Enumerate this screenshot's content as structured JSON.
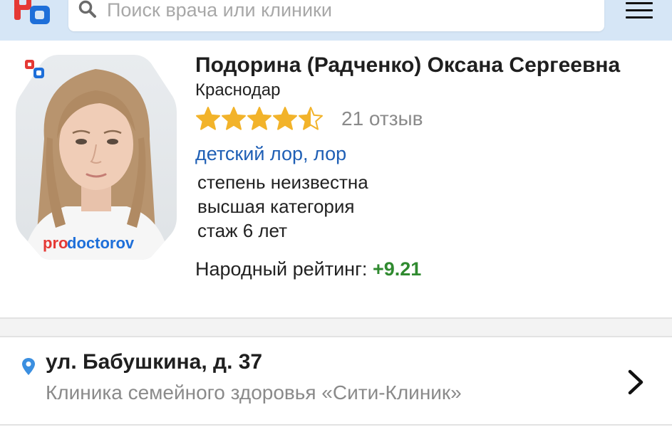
{
  "header": {
    "search_placeholder": "Поиск врача или клиники",
    "logo_icon": "prodoctorov-logo-icon",
    "menu_icon": "hamburger-menu-icon",
    "search_icon": "search-icon"
  },
  "doctor": {
    "name": "Подорина (Радченко) Оксана Сергеевна",
    "city": "Краснодар",
    "stars": 4.5,
    "reviews": "21 отзыв",
    "specialties": [
      "детский лор",
      "лор"
    ],
    "specialty_separator": ", ",
    "degree": "степень неизвестна",
    "category": "высшая категория",
    "experience": "стаж 6 лет",
    "rating_label": "Народный рейтинг: ",
    "rating_value": "+9.21",
    "photo_watermark_pro": "pro",
    "photo_watermark_doctorov": "doctorov"
  },
  "address": {
    "street": "ул. Бабушкина, д. 37",
    "clinic": "Клиника семейного здоровья «Сити-Клиник»",
    "pin_icon": "location-pin-icon",
    "chevron_icon": "chevron-right-icon"
  },
  "colors": {
    "header_bg": "#d6e6f6",
    "link": "#1f5fb5",
    "rating_positive": "#2f8a2f",
    "star": "#f2b32a",
    "pin": "#3b8fe0"
  }
}
